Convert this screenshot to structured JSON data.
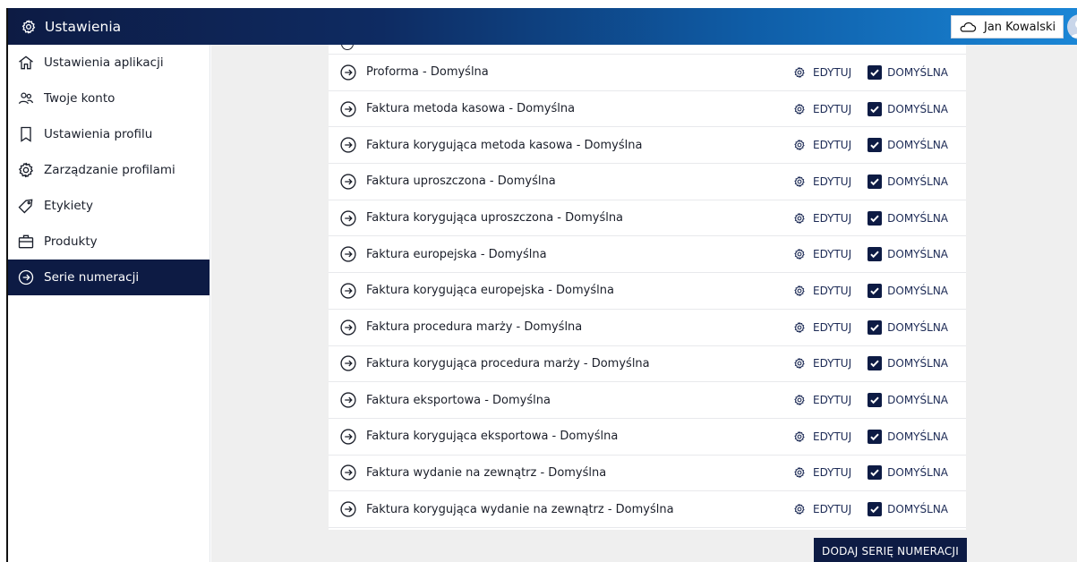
{
  "header": {
    "title": "Ustawienia",
    "user_name": "Jan Kowalski",
    "title_icon": "gear-icon",
    "user_icon": "cloud-icon"
  },
  "sidebar": {
    "items": [
      {
        "label": "Ustawienia aplikacji",
        "icon": "home-icon"
      },
      {
        "label": "Twoje konto",
        "icon": "users-icon"
      },
      {
        "label": "Ustawienia profilu",
        "icon": "bookmark-icon"
      },
      {
        "label": "Zarządzanie profilami",
        "icon": "gear-icon"
      },
      {
        "label": "Etykiety",
        "icon": "tag-icon"
      },
      {
        "label": "Produkty",
        "icon": "briefcase-icon"
      },
      {
        "label": "Serie numeracji",
        "icon": "arrow-circle-icon",
        "active": true
      }
    ]
  },
  "series": {
    "edit_label": "EDYTUJ",
    "default_label": "DOMYŚLNA",
    "rows": [
      "Proforma - Domyślna",
      "Faktura metoda kasowa - Domyślna",
      "Faktura korygująca metoda kasowa - Domyślna",
      "Faktura uproszczona - Domyślna",
      "Faktura korygująca uproszczona - Domyślna",
      "Faktura europejska - Domyślna",
      "Faktura korygująca europejska - Domyślna",
      "Faktura procedura marży - Domyślna",
      "Faktura korygująca procedura marży - Domyślna",
      "Faktura eksportowa - Domyślna",
      "Faktura korygująca eksportowa - Domyślna",
      "Faktura wydanie na zewnątrz - Domyślna",
      "Faktura korygująca wydanie na zewnątrz - Domyślna"
    ]
  },
  "actions": {
    "add_label": "DODAJ SERIĘ NUMERACJI"
  },
  "colors": {
    "navy": "#0d1b44",
    "content_bg": "#efefef"
  }
}
